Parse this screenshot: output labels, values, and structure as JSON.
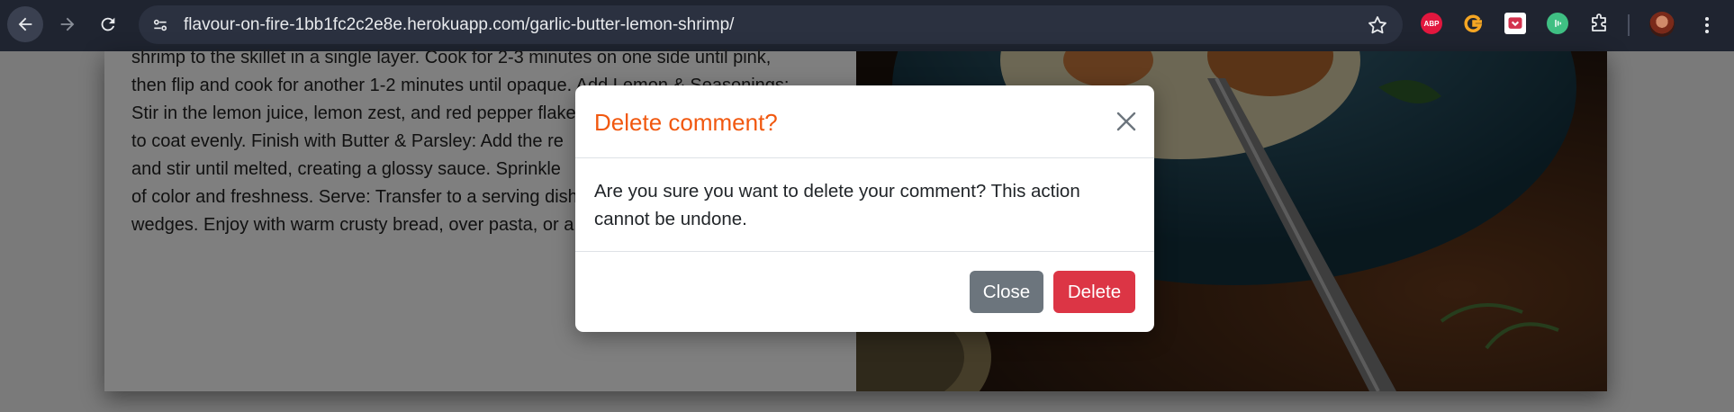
{
  "browser": {
    "url": "flavour-on-fire-1bb1fc2c2e8e.herokuapp.com/garlic-butter-lemon-shrimp/",
    "extensions": {
      "abp_label": "ABP"
    },
    "icons": [
      "back-icon",
      "forward-icon",
      "reload-icon",
      "site-info-icon",
      "bookmark-star-icon",
      "adblock-plus-icon",
      "g-extension-icon",
      "pocket-icon",
      "green-extension-icon",
      "extensions-puzzle-icon",
      "profile-avatar",
      "menu-kebab-icon"
    ]
  },
  "page": {
    "recipe_lines": [
      "shrimp to the skillet in a single layer. Cook for 2-3 minutes on one side until pink,",
      "then flip and cook for another 1-2 minutes until opaque. Add Lemon & Seasonings:",
      "Stir in the lemon juice, lemon zest, and red pepper flakes",
      "to coat evenly. Finish with Butter & Parsley: Add the re",
      "and stir until melted, creating a glossy sauce. Sprinkle",
      "of color and freshness. Serve: Transfer to a serving dish",
      "wedges. Enjoy with warm crusty bread, over pasta, or a"
    ]
  },
  "modal": {
    "title": "Delete comment?",
    "body": "Are you sure you want to delete your comment? This action cannot be undone.",
    "close_label": "Close",
    "delete_label": "Delete",
    "colors": {
      "title": "#f1580f",
      "close_button": "#6c757d",
      "delete_button": "#dc3545"
    }
  }
}
